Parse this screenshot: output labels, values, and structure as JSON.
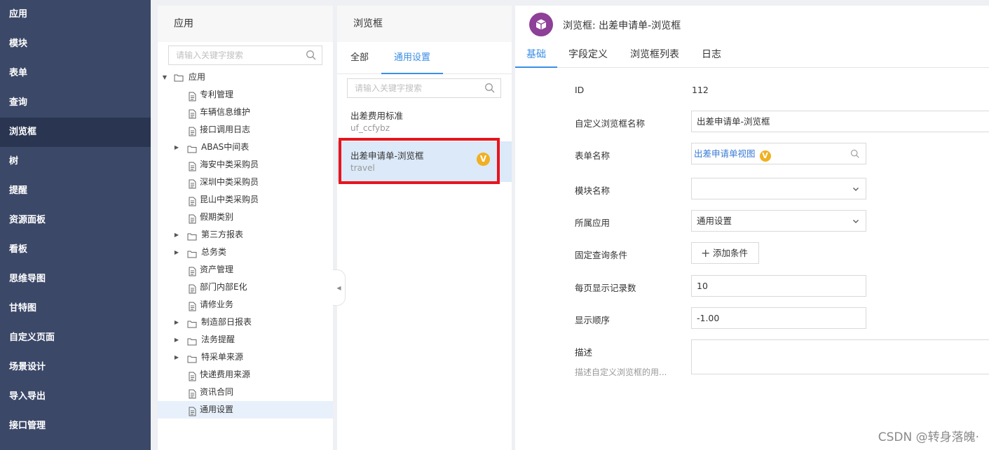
{
  "nav": {
    "items": [
      "应用",
      "模块",
      "表单",
      "查询",
      "浏览框",
      "树",
      "提醒",
      "资源面板",
      "看板",
      "思维导图",
      "甘特图",
      "自定义页面",
      "场景设计",
      "导入导出",
      "接口管理"
    ],
    "active_index": 4
  },
  "tree_panel": {
    "title": "应用",
    "search_placeholder": "请输入关键字搜索",
    "root_label": "应用",
    "items": [
      {
        "label": "专利管理",
        "type": "file"
      },
      {
        "label": "车辆信息维护",
        "type": "file"
      },
      {
        "label": "接口调用日志",
        "type": "file"
      },
      {
        "label": "ABAS中间表",
        "type": "folder"
      },
      {
        "label": "海安中类采购员",
        "type": "file"
      },
      {
        "label": "深圳中类采购员",
        "type": "file"
      },
      {
        "label": "昆山中类采购员",
        "type": "file"
      },
      {
        "label": "假期类别",
        "type": "file"
      },
      {
        "label": "第三方报表",
        "type": "folder"
      },
      {
        "label": "总务类",
        "type": "folder"
      },
      {
        "label": "资产管理",
        "type": "file"
      },
      {
        "label": "部门内部E化",
        "type": "file"
      },
      {
        "label": "请修业务",
        "type": "file"
      },
      {
        "label": "制造部日报表",
        "type": "folder"
      },
      {
        "label": "法务提醒",
        "type": "folder"
      },
      {
        "label": "特采单来源",
        "type": "folder"
      },
      {
        "label": "快递费用来源",
        "type": "file"
      },
      {
        "label": "资讯合同",
        "type": "file"
      },
      {
        "label": "通用设置",
        "type": "file"
      }
    ],
    "selected_label": "通用设置"
  },
  "browse_panel": {
    "title": "浏览框",
    "tabs": [
      "全部",
      "通用设置"
    ],
    "active_tab": "通用设置",
    "search_placeholder": "请输入关键字搜索",
    "items": [
      {
        "name": "出差费用标准",
        "code": "uf_ccfybz"
      },
      {
        "name": "出差申请单-浏览框",
        "code": "travel",
        "badge": "V"
      }
    ],
    "selected_index": 1
  },
  "detail": {
    "title": "浏览框: 出差申请单-浏览框",
    "tabs": [
      "基础",
      "字段定义",
      "浏览框列表",
      "日志"
    ],
    "active_tab": "基础",
    "labels": {
      "id": "ID",
      "name": "自定义浏览框名称",
      "form": "表单名称",
      "module": "模块名称",
      "app": "所属应用",
      "condition": "固定查询条件",
      "page_size": "每页显示记录数",
      "order": "显示顺序",
      "desc": "描述"
    },
    "values": {
      "id": "112",
      "name": "出差申请单-浏览框",
      "form": "出差申请单视图",
      "form_badge": "V",
      "module": "",
      "app": "通用设置",
      "add_condition_label": "添加条件",
      "page_size": "10",
      "order": "-1.00",
      "desc_hint": "描述自定义浏览框的用..."
    }
  },
  "watermark": "CSDN @转身落魄·",
  "colors": {
    "nav_bg": "#3b4868",
    "nav_active": "#2a3552",
    "accent": "#3a8ee6",
    "badge": "#f0b021",
    "highlight_box": "#e8141c",
    "logo": "#8e3f97"
  }
}
